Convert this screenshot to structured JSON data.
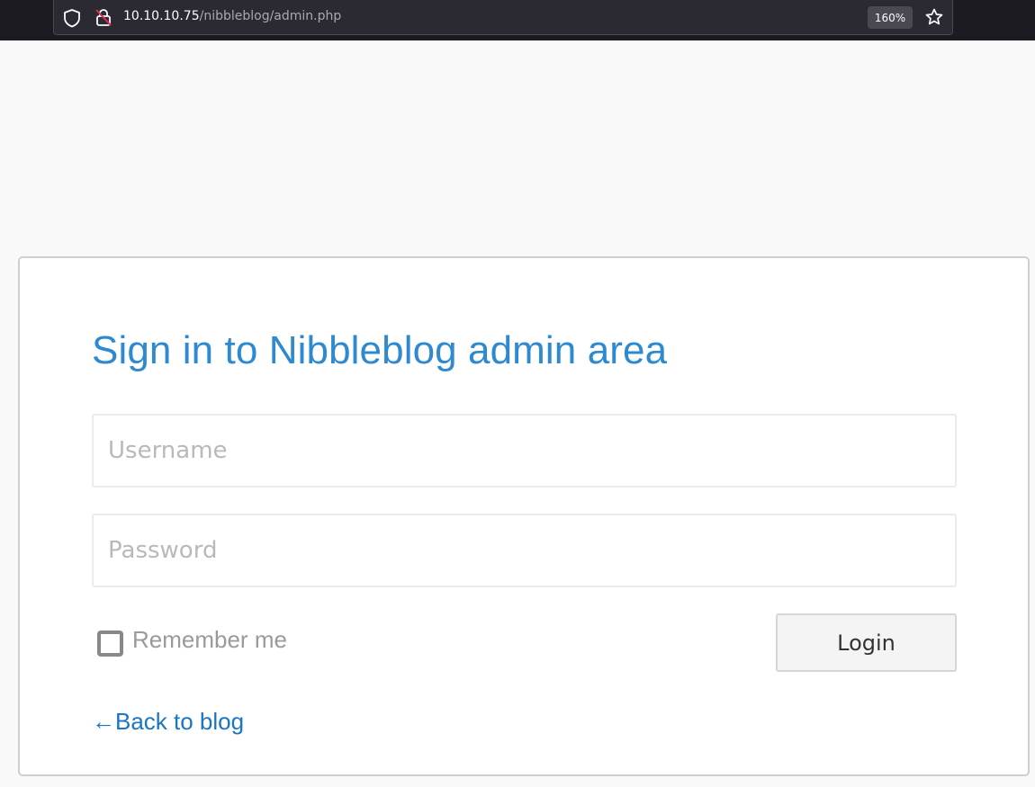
{
  "browser": {
    "url_host": "10.10.10.75",
    "url_path": "/nibbleblog/admin.php",
    "zoom": "160%",
    "icons": [
      "shield-icon",
      "insecure-lock-icon",
      "bookmark-star-icon"
    ]
  },
  "login": {
    "title": "Sign in to Nibbleblog admin area",
    "username_placeholder": "Username",
    "password_placeholder": "Password",
    "remember_label": "Remember me",
    "remember_checked": false,
    "login_label": "Login",
    "back_link": "←Back to blog"
  },
  "colors": {
    "title": "#2e8ad0",
    "link": "#1a75c4",
    "chrome_bg": "#1c1b22"
  }
}
